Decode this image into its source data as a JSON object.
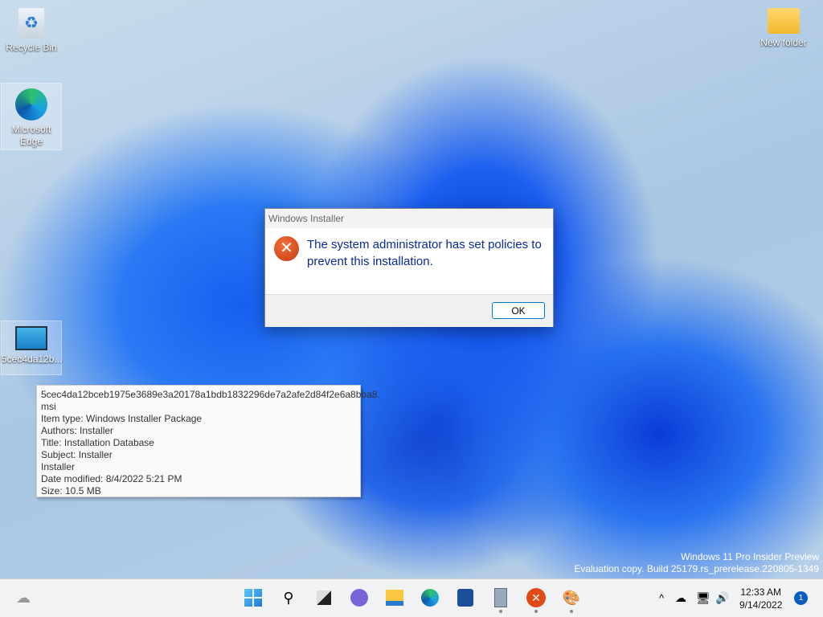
{
  "desktop": {
    "icons": [
      {
        "label": "Recycle Bin"
      },
      {
        "label": "Microsoft Edge"
      },
      {
        "label": "5cec4da12b..."
      },
      {
        "label": "New folder"
      }
    ]
  },
  "dialog": {
    "title": "Windows Installer",
    "message": "The system administrator has set policies to prevent this installation.",
    "ok_label": "OK",
    "icon": "error-icon"
  },
  "tooltip": {
    "lines": [
      "5cec4da12bceb1975e3689e3a20178a1bdb1832296de7a2afe2d84f2e6a8bba8.",
      "msi",
      "Item type: Windows Installer Package",
      "Authors: Installer",
      "Title: Installation Database",
      "Subject: Installer",
      "Installer",
      "Date modified: 8/4/2022 5:21 PM",
      "Size: 10.5 MB"
    ]
  },
  "watermark": {
    "line1": "Windows 11 Pro Insider Preview",
    "line2": "Evaluation copy. Build 25179.rs_prerelease.220805-1349"
  },
  "taskbar": {
    "time": "12:33 AM",
    "date": "9/14/2022",
    "notifications": "1"
  }
}
